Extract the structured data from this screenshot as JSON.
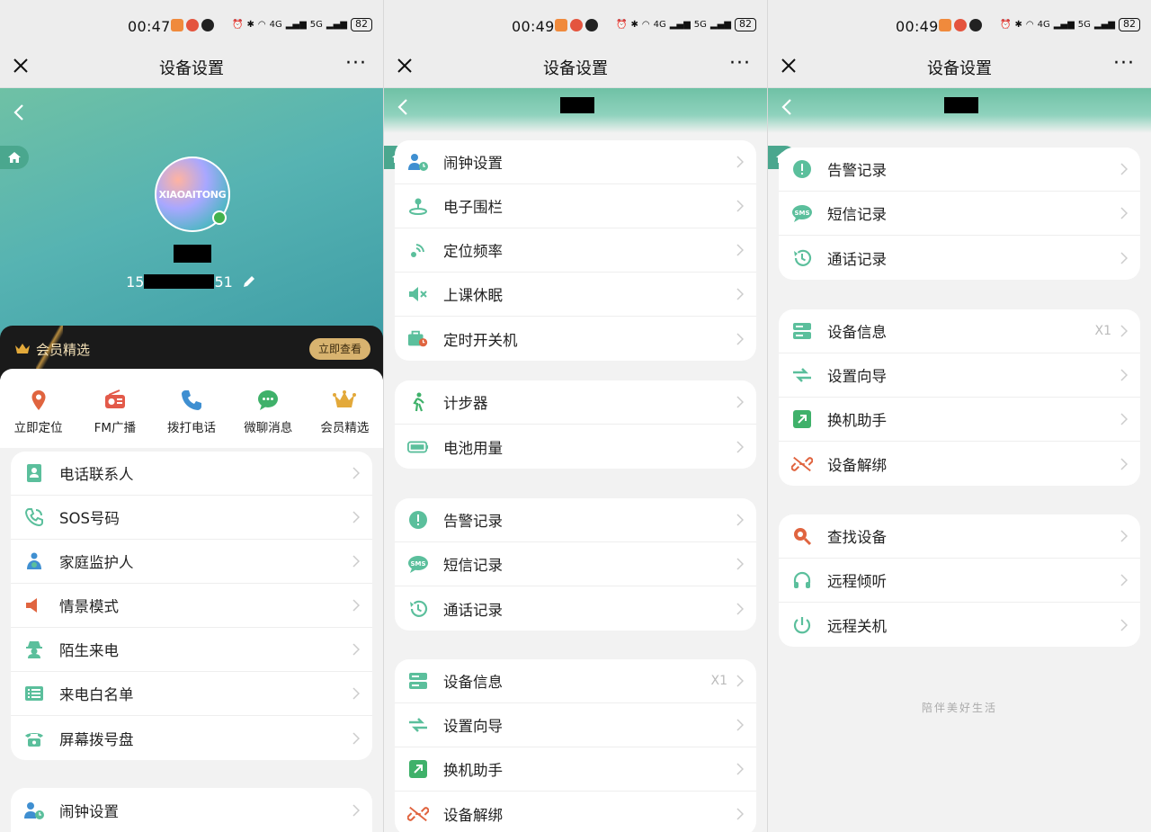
{
  "status": {
    "times": [
      "00:47",
      "00:49",
      "00:49"
    ],
    "network1": "4G",
    "network2": "5G",
    "battery": "82"
  },
  "nav": {
    "title": "设备设置",
    "more": "···"
  },
  "profile": {
    "avatar_text": "XIAOAITONG",
    "phone_prefix": "15",
    "phone_suffix": "51"
  },
  "member": {
    "label": "会员精选",
    "button": "立即查看"
  },
  "quick_actions": [
    {
      "label": "立即定位",
      "icon": "location-pin-icon",
      "color": "#e0643f"
    },
    {
      "label": "FM广播",
      "icon": "radio-icon",
      "color": "#e35a4a"
    },
    {
      "label": "拨打电话",
      "icon": "phone-icon",
      "color": "#3f8fd1"
    },
    {
      "label": "微聊消息",
      "icon": "chat-icon",
      "color": "#3fb16a"
    },
    {
      "label": "会员精选",
      "icon": "crown-icon",
      "color": "#e3a93a"
    }
  ],
  "panel1": {
    "card1": [
      {
        "label": "电话联系人",
        "icon": "contacts-icon"
      },
      {
        "label": "SOS号码",
        "icon": "sos-phone-icon"
      },
      {
        "label": "家庭监护人",
        "icon": "guardian-icon"
      },
      {
        "label": "情景模式",
        "icon": "speaker-icon"
      },
      {
        "label": "陌生来电",
        "icon": "stranger-icon"
      },
      {
        "label": "来电白名单",
        "icon": "list-icon"
      },
      {
        "label": "屏幕拨号盘",
        "icon": "dialpad-icon"
      }
    ],
    "card2": [
      {
        "label": "闹钟设置",
        "icon": "alarm-icon"
      }
    ]
  },
  "panel2": {
    "card1": [
      {
        "label": "闹钟设置",
        "icon": "alarm-icon"
      },
      {
        "label": "电子围栏",
        "icon": "geofence-icon"
      },
      {
        "label": "定位频率",
        "icon": "frequency-icon"
      },
      {
        "label": "上课休眠",
        "icon": "mute-icon"
      },
      {
        "label": "定时开关机",
        "icon": "timer-power-icon"
      }
    ],
    "card2": [
      {
        "label": "计步器",
        "icon": "walk-icon"
      },
      {
        "label": "电池用量",
        "icon": "battery-icon"
      }
    ],
    "card3": [
      {
        "label": "告警记录",
        "icon": "alert-icon"
      },
      {
        "label": "短信记录",
        "icon": "sms-icon"
      },
      {
        "label": "通话记录",
        "icon": "history-icon"
      }
    ],
    "card4": [
      {
        "label": "设备信息",
        "icon": "device-info-icon",
        "value": "X1"
      },
      {
        "label": "设置向导",
        "icon": "guide-icon"
      },
      {
        "label": "换机助手",
        "icon": "transfer-icon"
      },
      {
        "label": "设备解绑",
        "icon": "unlink-icon"
      }
    ]
  },
  "panel3": {
    "card1": [
      {
        "label": "告警记录",
        "icon": "alert-icon"
      },
      {
        "label": "短信记录",
        "icon": "sms-icon"
      },
      {
        "label": "通话记录",
        "icon": "history-icon"
      }
    ],
    "card2": [
      {
        "label": "设备信息",
        "icon": "device-info-icon",
        "value": "X1"
      },
      {
        "label": "设置向导",
        "icon": "guide-icon"
      },
      {
        "label": "换机助手",
        "icon": "transfer-icon"
      },
      {
        "label": "设备解绑",
        "icon": "unlink-icon"
      }
    ],
    "card3": [
      {
        "label": "查找设备",
        "icon": "find-device-icon"
      },
      {
        "label": "远程倾听",
        "icon": "headphones-icon"
      },
      {
        "label": "远程关机",
        "icon": "power-icon"
      }
    ],
    "footer": "陪伴美好生活"
  },
  "colors": {
    "accent": "#5bbf9c",
    "orange": "#e0643f",
    "page_bg": "#f2f2f2"
  }
}
